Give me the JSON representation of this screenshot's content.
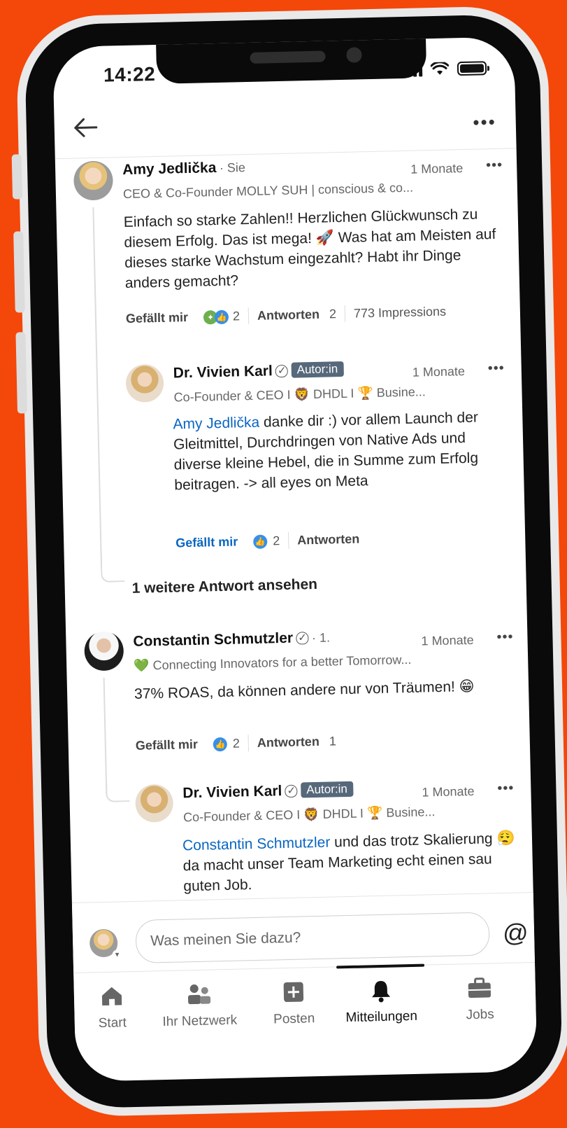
{
  "status_bar": {
    "time": "14:22"
  },
  "header": {
    "back_icon": "arrow-left-icon",
    "more_icon": "more-horizontal-icon"
  },
  "comments": [
    {
      "author": "Amy Jedlička",
      "relation": "· Sie",
      "headline": "CEO & Co-Founder MOLLY SUH | conscious & co...",
      "time": "1 Monate",
      "text": "Einfach so starke Zahlen!! Herzlichen Glückwunsch zu diesem Erfolg. Das ist mega! 🚀 Was hat am Meisten auf dieses starke Wachstum eingezahlt? Habt ihr Dinge anders gemacht?",
      "like_label": "Gefällt mir",
      "reaction_count": "2",
      "reply_label": "Antworten",
      "reply_count": "2",
      "impressions": "773 Impressions",
      "reply": {
        "author": "Dr. Vivien Karl",
        "badge": "Autor:in",
        "headline": "Co-Founder & CEO I 🦁 DHDL I 🏆 Busine...",
        "time": "1 Monate",
        "mention": "Amy Jedlička",
        "text": " danke dir :) vor allem Launch der Gleitmittel, Durchdringen von Native Ads und diverse kleine Hebel, die in Summe zum Erfolg beitragen. -> all eyes on Meta",
        "like_label": "Gefällt mir",
        "reaction_count": "2",
        "reply_label": "Antworten"
      },
      "more_replies": "1 weitere Antwort ansehen"
    },
    {
      "author": "Constantin Schmutzler",
      "relation": "· 1.",
      "headline": "💚 Connecting Innovators for a better Tomorrow...",
      "time": "1 Monate",
      "text": "37% ROAS, da können andere nur von Träumen! 😁",
      "like_label": "Gefällt mir",
      "reaction_count": "2",
      "reply_label": "Antworten",
      "reply_count": "1",
      "reply": {
        "author": "Dr. Vivien Karl",
        "badge": "Autor:in",
        "headline": "Co-Founder & CEO I 🦁 DHDL I 🏆 Busine...",
        "time": "1 Monate",
        "mention": "Constantin Schmutzler",
        "text": " und das trotz Skalierung 😮‍💨 da macht unser Team Marketing echt einen sau guten Job."
      }
    }
  ],
  "composer": {
    "placeholder": "Was meinen Sie dazu?",
    "mention_symbol": "@"
  },
  "tabs": [
    {
      "label": "Start",
      "icon": "home-icon"
    },
    {
      "label": "Ihr Netzwerk",
      "icon": "network-icon"
    },
    {
      "label": "Posten",
      "icon": "plus-square-icon"
    },
    {
      "label": "Mitteilungen",
      "icon": "bell-icon",
      "active": true
    },
    {
      "label": "Jobs",
      "icon": "briefcase-icon"
    }
  ],
  "colors": {
    "background": "#f4470a",
    "link": "#0a66c2",
    "badge": "#56687a",
    "like": "#378fe9"
  }
}
